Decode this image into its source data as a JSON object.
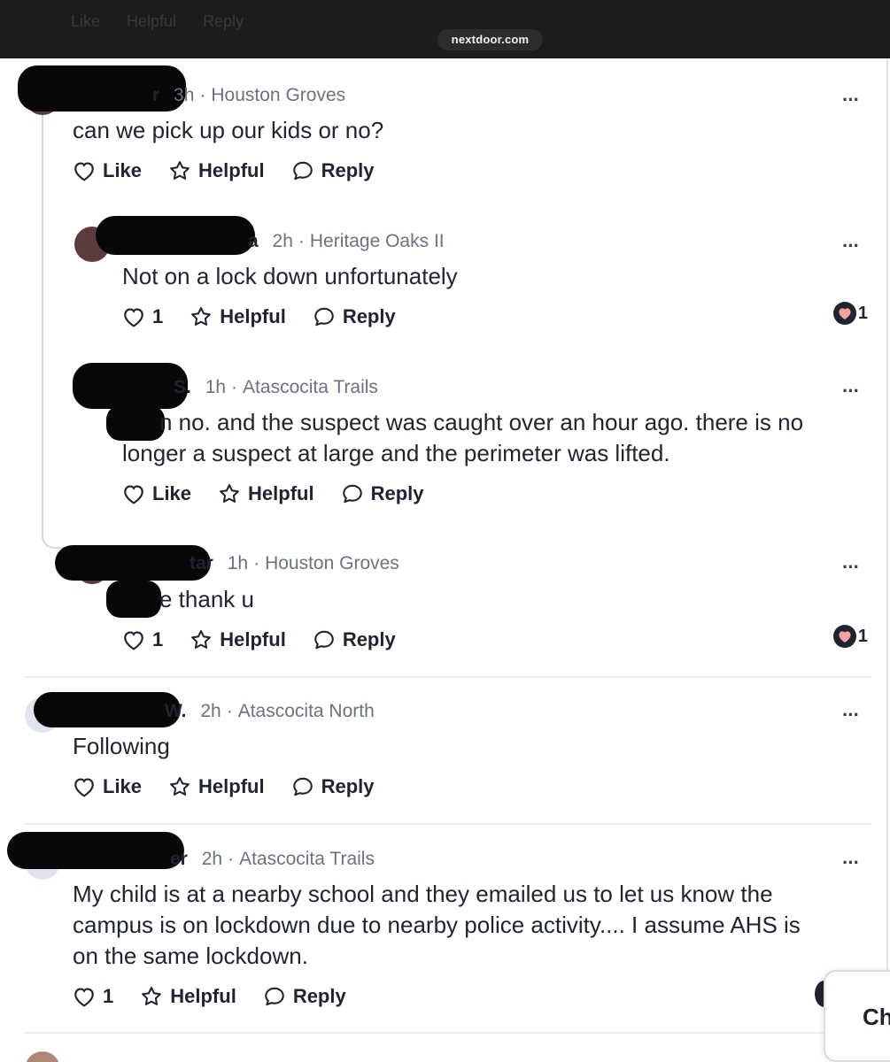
{
  "browser": {
    "url": "nextdoor.com",
    "ghost_toolbar": [
      "Like",
      "Helpful",
      "Reply"
    ]
  },
  "comments": [
    {
      "name_tail": "r",
      "time": "3h",
      "neighborhood": "Houston Groves",
      "text": [
        "can we pick up our kids or no?"
      ],
      "like_label": "Like",
      "helpful_label": "Helpful",
      "reply_label": "Reply",
      "more_label": "···"
    },
    {
      "name_tail": "a",
      "time": "2h",
      "neighborhood": "Heritage Oaks II",
      "text": [
        "Not on a lock down unfortunately"
      ],
      "like_label": "1",
      "helpful_label": "Helpful",
      "reply_label": "Reply",
      "more_label": "···",
      "reaction_count": "1"
    },
    {
      "name_tail": "S.",
      "time": "1h",
      "neighborhood": "Atascocita Trails",
      "text": [
        "n no. and the suspect was caught over an hour ago. there is no",
        "longer a suspect at large and the perimeter was lifted."
      ],
      "like_label": "Like",
      "helpful_label": "Helpful",
      "reply_label": "Reply",
      "more_label": "···"
    },
    {
      "name_tail": "tar",
      "time": "1h",
      "neighborhood": "Houston Groves",
      "text": [
        "e thank u"
      ],
      "like_label": "1",
      "helpful_label": "Helpful",
      "reply_label": "Reply",
      "more_label": "···",
      "reaction_count": "1"
    },
    {
      "name_tail": "W.",
      "time": "2h",
      "neighborhood": "Atascocita North",
      "text": [
        "Following"
      ],
      "like_label": "Like",
      "helpful_label": "Helpful",
      "reply_label": "Reply",
      "more_label": "···"
    },
    {
      "name_tail": "er",
      "time": "2h",
      "neighborhood": "Atascocita Trails",
      "text": [
        "My child is at a nearby school and they emailed us to let us know the",
        "campus is on lockdown due to nearby police activity.... I assume AHS is",
        "on the same lockdown."
      ],
      "like_label": "1",
      "helpful_label": "Helpful",
      "reply_label": "Reply",
      "more_label": "···"
    }
  ],
  "chat": {
    "label": "Ch"
  },
  "colors": {
    "reaction_heart": "#f4a3a3",
    "topbar": "#1c1c1e",
    "text": "#1f2430",
    "meta": "#6b7280"
  },
  "icons": {
    "like": "heart-outline-icon",
    "helpful": "star-outline-icon",
    "reply": "speech-bubble-icon",
    "more": "ellipsis-icon",
    "reaction": "heart-filled-icon"
  }
}
